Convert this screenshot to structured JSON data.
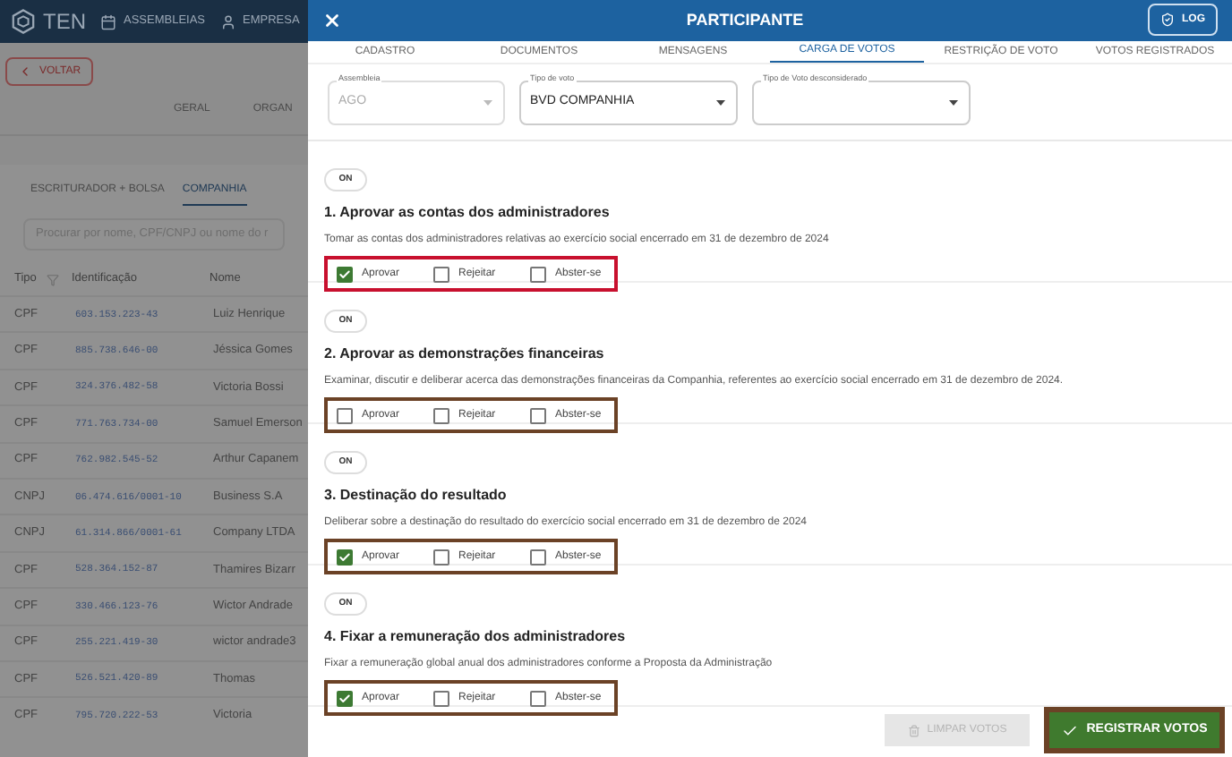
{
  "background": {
    "brand": "TEN",
    "nav": [
      {
        "label": "ASSEMBLEIAS",
        "kind": "calendar"
      },
      {
        "label": "EMPRESA",
        "kind": "user"
      }
    ],
    "back_button": "VOLTAR",
    "section_tabs": [
      "GERAL",
      "ORGAN"
    ],
    "list_tabs": [
      {
        "label": "ESCRITURADOR + BOLSA",
        "selected": false
      },
      {
        "label": "COMPANHIA",
        "selected": true
      }
    ],
    "search": {
      "placeholder": "Procurar por nome, CPF/CNPJ ou nome do r"
    },
    "table": {
      "columns": [
        "Tipo",
        "Identificação",
        "Nome"
      ],
      "rows": [
        {
          "tipo": "CPF",
          "identificacao": "603.153.223-43",
          "nome": "Luiz Henrique"
        },
        {
          "tipo": "CPF",
          "identificacao": "885.738.646-00",
          "nome": "Jéssica Gomes"
        },
        {
          "tipo": "CPF",
          "identificacao": "324.376.482-58",
          "nome": "Victoria Bossi"
        },
        {
          "tipo": "CPF",
          "identificacao": "771.763.734-00",
          "nome": "Samuel Emerson"
        },
        {
          "tipo": "CPF",
          "identificacao": "762.982.545-52",
          "nome": "Arthur Capanem"
        },
        {
          "tipo": "CNPJ",
          "identificacao": "06.474.616/0001-10",
          "nome": "Business S.A"
        },
        {
          "tipo": "CNPJ",
          "identificacao": "61.314.866/0001-61",
          "nome": "Company LTDA"
        },
        {
          "tipo": "CPF",
          "identificacao": "528.364.152-87",
          "nome": "Thamires Bizarr"
        },
        {
          "tipo": "CPF",
          "identificacao": "330.466.123-76",
          "nome": "Wictor Andrade"
        },
        {
          "tipo": "CPF",
          "identificacao": "255.221.419-30",
          "nome": "wictor andrade3"
        },
        {
          "tipo": "CPF",
          "identificacao": "526.521.420-89",
          "nome": "Thomas"
        },
        {
          "tipo": "CPF",
          "identificacao": "795.720.222-53",
          "nome": "Victoria"
        }
      ]
    }
  },
  "modal": {
    "title": "PARTICIPANTE",
    "log_button": "LOG",
    "tabs": [
      {
        "label": "CADASTRO",
        "selected": false
      },
      {
        "label": "DOCUMENTOS",
        "selected": false
      },
      {
        "label": "MENSAGENS",
        "selected": false
      },
      {
        "label": "CARGA DE VOTOS",
        "selected": true
      },
      {
        "label": "RESTRIÇÃO DE VOTO",
        "selected": false
      },
      {
        "label": "VOTOS REGISTRADOS",
        "selected": false
      }
    ],
    "fields": [
      {
        "label": "Assembleia",
        "value": "AGO",
        "disabled": true
      },
      {
        "label": "Tipo de voto",
        "value": "BVD COMPANHIA",
        "disabled": false
      },
      {
        "label": "Tipo de Voto desconsiderado",
        "disabled": false
      }
    ],
    "questions": [
      {
        "toggle": "ON",
        "title": "1. Aprovar as contas dos administradores",
        "description": "Tomar as contas dos administradores relativas ao exercício social encerrado em 31 de dezembro de 2024",
        "color": "#c8102e",
        "options": [
          {
            "label": "Aprovar",
            "checked": true
          },
          {
            "label": "Rejeitar",
            "checked": false
          },
          {
            "label": "Abster-se",
            "checked": false
          }
        ]
      },
      {
        "toggle": "ON",
        "title": "2. Aprovar as demonstrações financeiras",
        "description": "Examinar, discutir e deliberar acerca das demonstrações financeiras da Companhia, referentes ao exercício social encerrado em 31 de dezembro de 2024.",
        "color": "#6b4226",
        "options": [
          {
            "label": "Aprovar",
            "checked": false
          },
          {
            "label": "Rejeitar",
            "checked": false
          },
          {
            "label": "Abster-se",
            "checked": false
          }
        ]
      },
      {
        "toggle": "ON",
        "title": "3. Destinação do resultado",
        "description": "Deliberar sobre a destinação do resultado do exercício social encerrado em 31 de dezembro de 2024",
        "color": "#6b4226",
        "options": [
          {
            "label": "Aprovar",
            "checked": true
          },
          {
            "label": "Rejeitar",
            "checked": false
          },
          {
            "label": "Abster-se",
            "checked": false
          }
        ]
      },
      {
        "toggle": "ON",
        "title": "4. Fixar a remuneração dos administradores",
        "description": "Fixar a remuneração global anual dos administradores conforme a Proposta da Administração",
        "color": "#6b4226",
        "options": [
          {
            "label": "Aprovar",
            "checked": true
          },
          {
            "label": "Rejeitar",
            "checked": false
          },
          {
            "label": "Abster-se",
            "checked": false
          }
        ]
      }
    ],
    "clear_button": {
      "label": "LIMPAR VOTOS",
      "disabled": true
    },
    "register_button": {
      "label": "REGISTRAR VOTOS",
      "color": "#6b4226"
    }
  }
}
